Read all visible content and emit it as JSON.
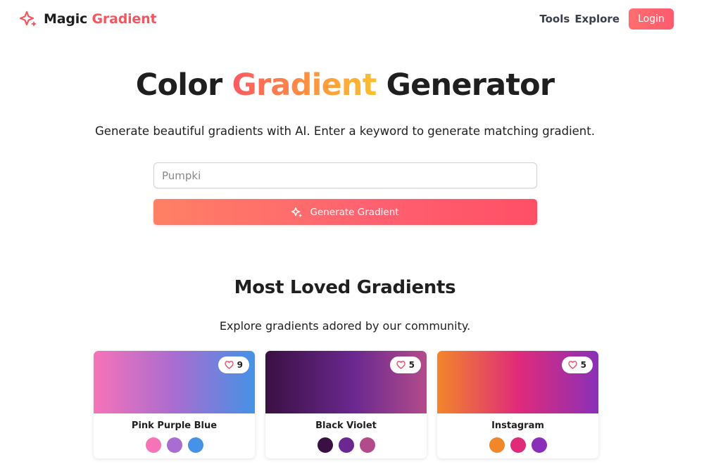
{
  "brand": {
    "name_part1": "Magic",
    "name_part2": "Gradient",
    "logo_icon": "sparkles-icon",
    "color": "#f2565f"
  },
  "nav": {
    "links": [
      "Tools",
      "Explore"
    ],
    "login_label": "Login"
  },
  "hero": {
    "title_part1": "Color",
    "title_part2": "Gradient",
    "title_part3": "Generator",
    "subtitle": "Generate beautiful gradients with AI. Enter a keyword to generate matching gradient.",
    "input_value": "Pumpki",
    "button_label": "Generate Gradient",
    "button_icon": "sparkles-icon"
  },
  "section": {
    "title": "Most Loved Gradients",
    "subtitle": "Explore gradients adored by our community."
  },
  "cards": [
    {
      "name": "Pink Purple Blue",
      "likes": "9",
      "colors": [
        "#f673b8",
        "#a96cd0",
        "#4592e6"
      ]
    },
    {
      "name": "Black Violet",
      "likes": "5",
      "colors": [
        "#3a1042",
        "#6a2890",
        "#b34b8a"
      ]
    },
    {
      "name": "Instagram",
      "likes": "5",
      "colors": [
        "#f2862a",
        "#e02b79",
        "#8a30b8"
      ]
    }
  ],
  "colors": {
    "accent": "#ff5a6e",
    "heart": "#e84a5f"
  }
}
